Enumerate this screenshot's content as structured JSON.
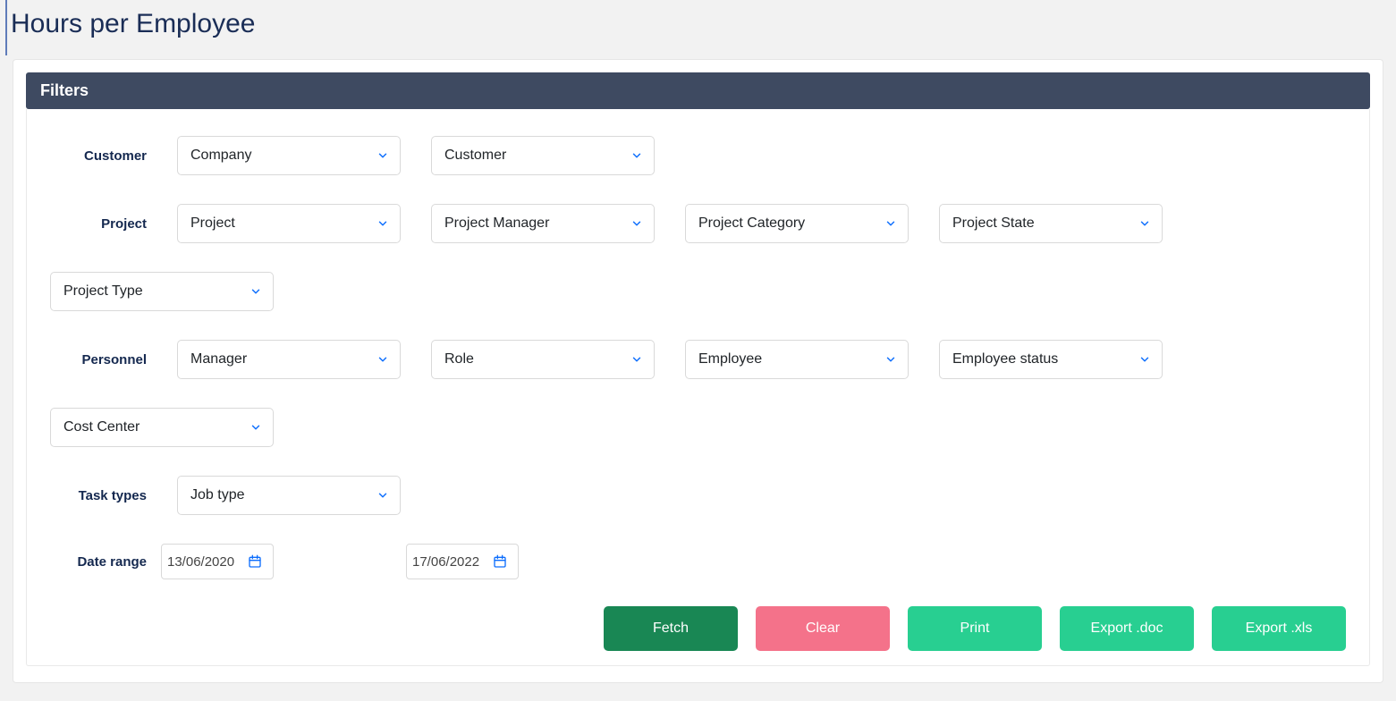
{
  "page": {
    "title": "Hours per Employee"
  },
  "panel": {
    "header": "Filters"
  },
  "labels": {
    "customer": "Customer",
    "project": "Project",
    "personnel": "Personnel",
    "task_types": "Task types",
    "date_range": "Date range"
  },
  "selects": {
    "company": "Company",
    "customer": "Customer",
    "project": "Project",
    "project_manager": "Project Manager",
    "project_category": "Project Category",
    "project_state": "Project State",
    "project_type": "Project Type",
    "manager": "Manager",
    "role": "Role",
    "employee": "Employee",
    "employee_status": "Employee status",
    "cost_center": "Cost Center",
    "job_type": "Job type"
  },
  "dates": {
    "from": "13/06/2020",
    "to": "17/06/2022"
  },
  "buttons": {
    "fetch": "Fetch",
    "clear": "Clear",
    "print": "Print",
    "export_doc": "Export .doc",
    "export_xls": "Export .xls"
  }
}
